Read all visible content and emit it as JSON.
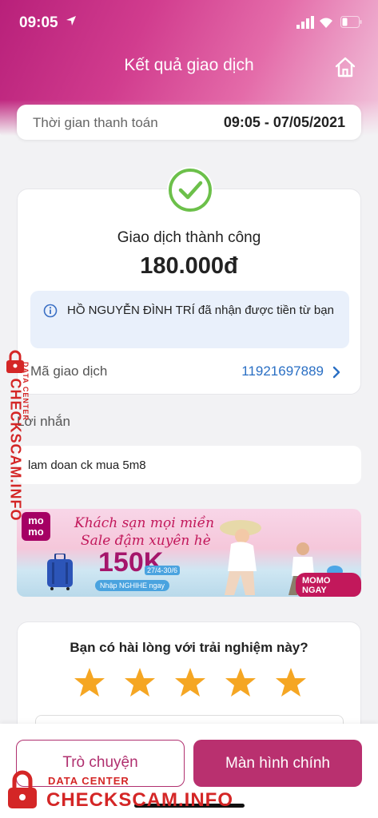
{
  "status_bar": {
    "time": "09:05",
    "icons": [
      "location-arrow-icon",
      "signal-icon",
      "wifi-icon",
      "battery-icon"
    ]
  },
  "nav": {
    "title": "Kết quả giao dịch",
    "home_icon": "home-icon"
  },
  "payment_time": {
    "label": "Thời gian thanh toán",
    "value": "09:05 - 07/05/2021"
  },
  "result": {
    "status": "Giao dịch thành công",
    "amount": "180.000đ",
    "info": "HỒ NGUYỄN ĐÌNH TRÍ đã nhận được tiền từ bạn",
    "txn_label": "Mã giao dịch",
    "txn_id": "11921697889"
  },
  "message": {
    "label": "Lời nhắn",
    "text": "lam doan ck mua 5m8"
  },
  "banner": {
    "logo": "mo mo",
    "line1": "Khách sạn mọi miền",
    "line2": "Sale đậm xuyên hè",
    "big": "150K",
    "date": "27/4-30/6",
    "code": "Nhập NGHIHE ngay",
    "cta": "MOMO NGAY"
  },
  "survey": {
    "question": "Bạn có hài lòng với trải nghiệm này?",
    "stars": 5,
    "star_color": "#f5a623"
  },
  "actions": {
    "chat": "Trò chuyện",
    "main": "Màn hình chính"
  },
  "watermark": {
    "sub": "DATA CENTER",
    "text": "CHECKSCAM.INFO"
  },
  "colors": {
    "brand": "#b9306f",
    "success": "#6cc04a",
    "link": "#2a6fc4"
  }
}
